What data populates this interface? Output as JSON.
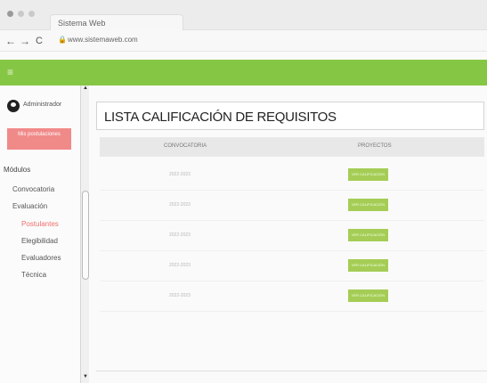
{
  "window": {
    "tab_title": "Sistema Web",
    "url": "www.sistemaweb.com"
  },
  "sidebar": {
    "admin_label": "Administrador",
    "user_button_label": "Mis postulaciones",
    "modules_title": "Módulos",
    "items": [
      {
        "label": "Convocatoria"
      },
      {
        "label": "Evaluación"
      },
      {
        "label": "Postulantes"
      },
      {
        "label": "Elegibilidad"
      },
      {
        "label": "Evaluadores"
      },
      {
        "label": "Técnica"
      }
    ]
  },
  "main": {
    "page_title": "LISTA CALIFICACIÓN DE REQUISITOS",
    "table": {
      "columns": [
        "CONVOCATORIA",
        "PROYECTOS"
      ],
      "rows": [
        {
          "convocatoria": "2022-2023",
          "action": "VER CALIFICACIÓN"
        },
        {
          "convocatoria": "2022-2023",
          "action": "VER CALIFICACIÓN"
        },
        {
          "convocatoria": "2022-2023",
          "action": "VER CALIFICACIÓN"
        },
        {
          "convocatoria": "2022-2023",
          "action": "VER CALIFICACIÓN"
        },
        {
          "convocatoria": "2022-2023",
          "action": "VER CALIFICACIÓN"
        }
      ]
    }
  },
  "colors": {
    "accent_green": "#86c645",
    "button_green": "#a5cd55",
    "user_button_red": "#f08a89",
    "active_item_red": "#ef6f6f"
  },
  "icons": {
    "menu": "hamburger-icon",
    "avatar": "user-avatar-icon",
    "back": "arrow-left-icon",
    "forward": "arrow-right-icon",
    "reload": "reload-icon",
    "lock": "lock-icon"
  }
}
